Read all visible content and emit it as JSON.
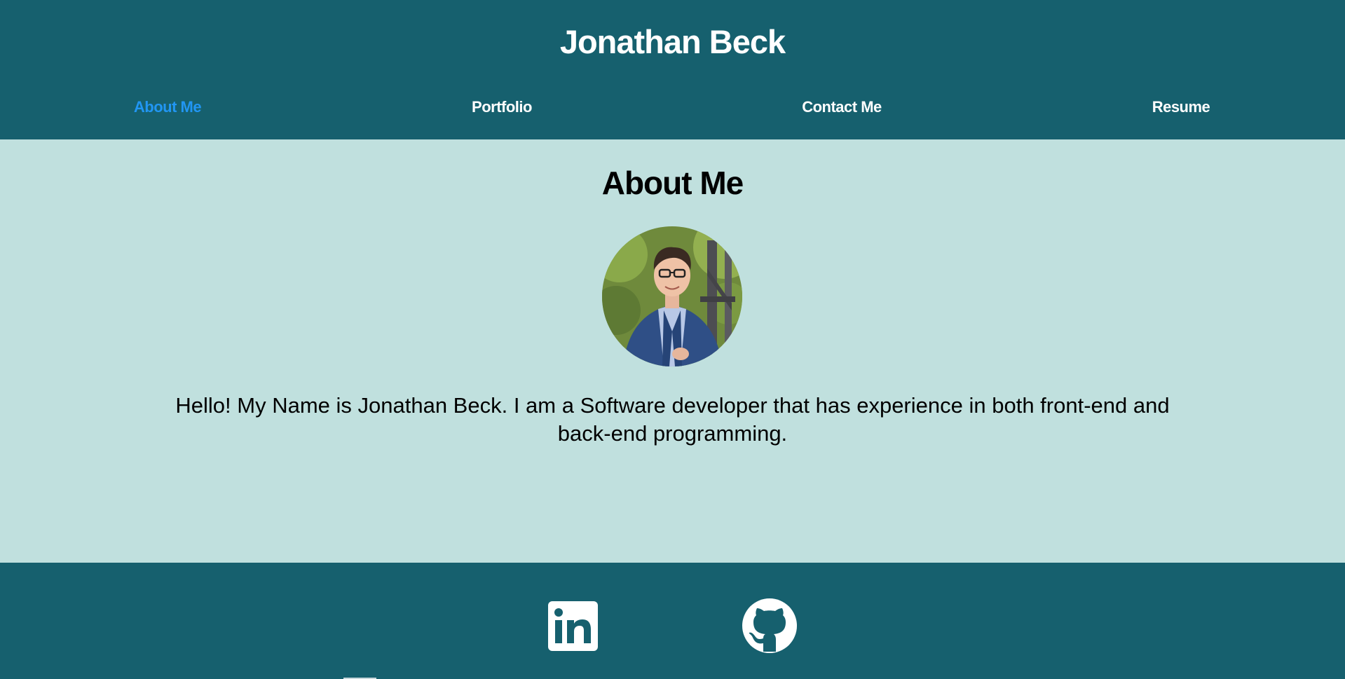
{
  "header": {
    "title": "Jonathan Beck",
    "nav": [
      {
        "label": "About Me",
        "active": true
      },
      {
        "label": "Portfolio",
        "active": false
      },
      {
        "label": "Contact Me",
        "active": false
      },
      {
        "label": "Resume",
        "active": false
      }
    ]
  },
  "main": {
    "heading": "About Me",
    "bio": "Hello! My Name is Jonathan Beck. I am a Software developer that has experience in both front-end and back-end programming."
  },
  "footer": {
    "icons": [
      "linkedin-icon",
      "github-icon"
    ]
  },
  "colors": {
    "header_bg": "#16606e",
    "main_bg": "#c0e0de",
    "nav_active": "#2196f3",
    "nav_text": "#ffffff"
  }
}
